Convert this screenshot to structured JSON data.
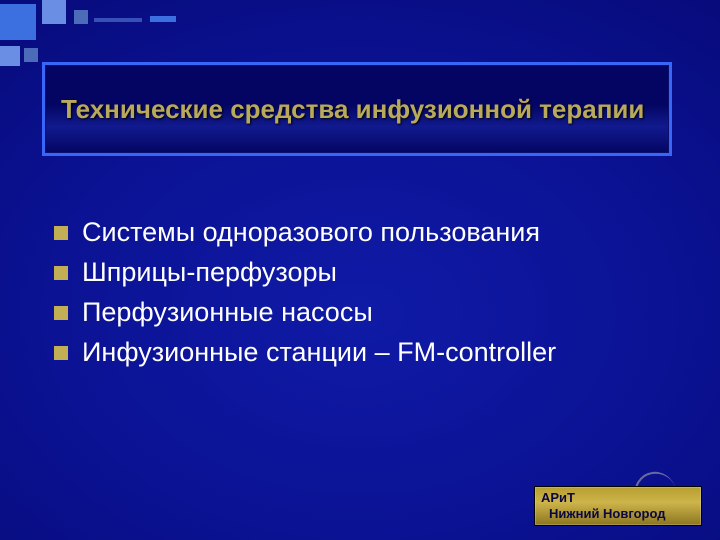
{
  "title": "Технические средства инфузионной терапии",
  "bullets": [
    "Системы одноразового пользования",
    "Шприцы-перфузоры",
    "Перфузионные насосы",
    "Инфузионные станции – FM-controller"
  ],
  "footer": {
    "line1": "АРиТ",
    "line2": "Нижний Новгород"
  }
}
